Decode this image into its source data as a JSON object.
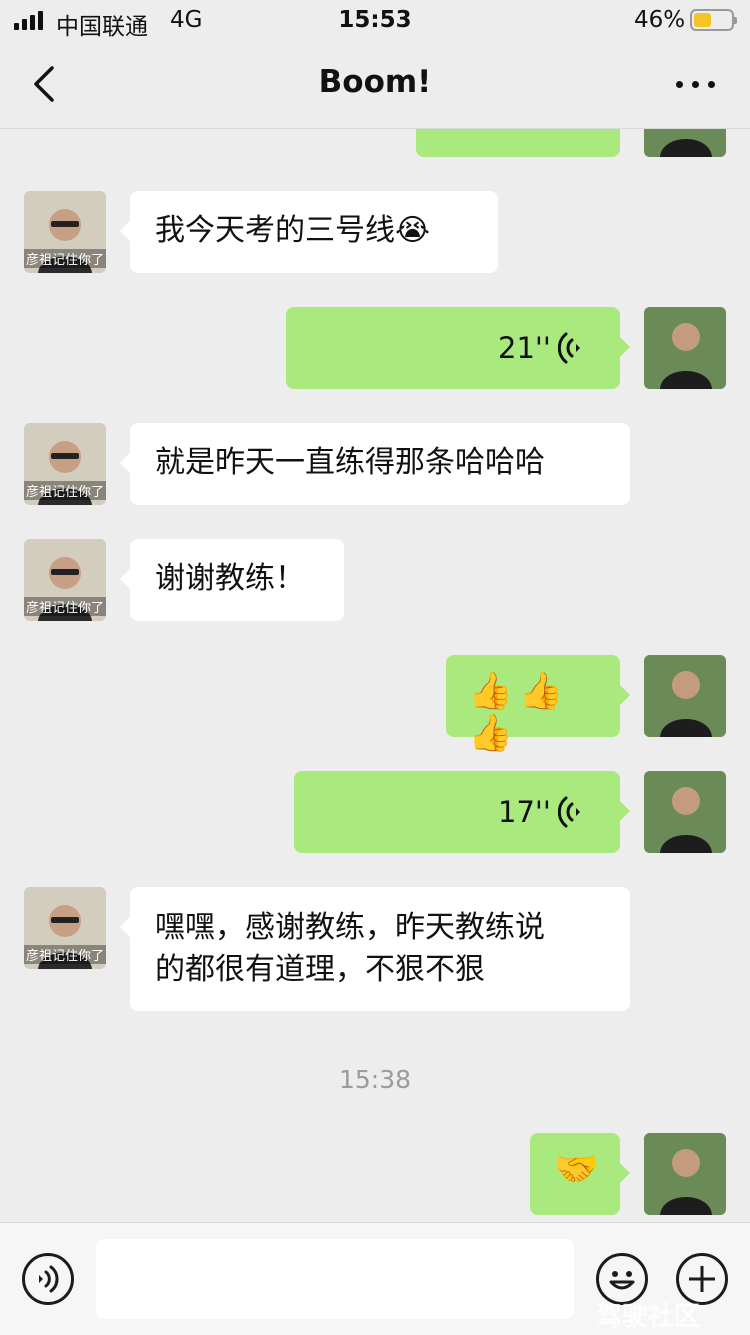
{
  "status_bar": {
    "carrier": "中国联通",
    "network": "4G",
    "time": "15:53",
    "battery_percent": "46%",
    "battery_level": 0.46,
    "battery_color": "#f5c324"
  },
  "nav": {
    "title": "Boom!",
    "back_icon": "chevron-left-icon",
    "more_icon": "ellipsis-icon"
  },
  "messages": [
    {
      "from": "friend",
      "type": "text",
      "text": "我今天考的三号线😭"
    },
    {
      "from": "me",
      "type": "voice",
      "duration": "21''"
    },
    {
      "from": "friend",
      "type": "text",
      "text": "就是昨天一直练得那条哈哈哈"
    },
    {
      "from": "friend",
      "type": "text",
      "text": "谢谢教练！"
    },
    {
      "from": "me",
      "type": "emoji",
      "text": "👍👍👍"
    },
    {
      "from": "me",
      "type": "voice",
      "duration": "17''"
    },
    {
      "from": "friend",
      "type": "text",
      "lines": [
        "嘿嘿，感谢教练，昨天教练说",
        "的都很有道理，不狠不狠"
      ]
    },
    {
      "from": "me",
      "type": "emoji",
      "text": "🤝"
    }
  ],
  "friend_avatar_caption": "彦祖记住你了",
  "timestamp": "15:38",
  "input_bar": {
    "voice_icon": "voice-icon",
    "emoji_icon": "smiley-icon",
    "plus_icon": "plus-icon"
  },
  "watermark": "驾驶社区",
  "colors": {
    "background": "#ededed",
    "my_bubble": "#a9e97d",
    "friend_bubble": "#ffffff"
  }
}
